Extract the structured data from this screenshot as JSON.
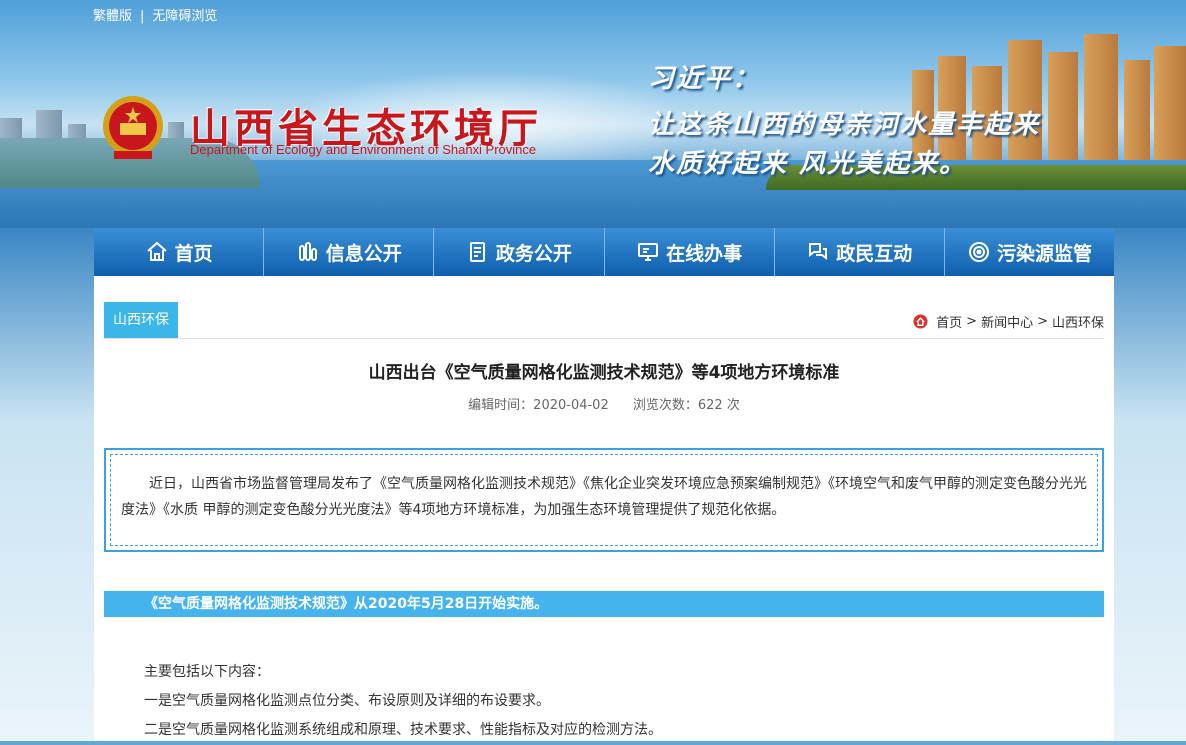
{
  "top_links": {
    "traditional": "繁體版",
    "separator": "|",
    "accessible": "无障碍浏览"
  },
  "header": {
    "title": "山西省生态环境厅",
    "subtitle": "Department of Ecology and Environment of Shanxi Province",
    "quote_author": "习近平：",
    "quote_line1": "让这条山西的母亲河水量丰起来",
    "quote_line2": "水质好起来  风光美起来。"
  },
  "nav": {
    "items": [
      {
        "label": "首页",
        "icon": "home-icon"
      },
      {
        "label": "信息公开",
        "icon": "info-icon"
      },
      {
        "label": "政务公开",
        "icon": "document-icon"
      },
      {
        "label": "在线办事",
        "icon": "monitor-icon"
      },
      {
        "label": "政民互动",
        "icon": "interaction-icon"
      },
      {
        "label": "污染源监管",
        "icon": "target-icon"
      }
    ]
  },
  "section": {
    "tab": "山西环保"
  },
  "breadcrumb": {
    "home": "首页",
    "sep1": ">",
    "news": "新闻中心",
    "sep2": ">",
    "current": "山西环保"
  },
  "article": {
    "title": "山西出台《空气质量网格化监测技术规范》等4项地方环境标准",
    "edit_time": "编辑时间：2020-04-02",
    "views": "浏览次数：622 次",
    "summary": "近日，山西省市场监督管理局发布了《空气质量网格化监测技术规范》《焦化企业突发环境应急预案编制规范》《环境空气和废气甲醇的测定变色酸分光光度法》《水质 甲醇的测定变色酸分光光度法》等4项地方环境标准，为加强生态环境管理提供了规范化依据。",
    "subhead": "《空气质量网格化监测技术规范》从2020年5月28日开始实施。",
    "para1": "主要包括以下内容：",
    "para2": "一是空气质量网格化监测点位分类、布设原则及详细的布设要求。",
    "para3": "二是空气质量网格化监测系统组成和原理、技术要求、性能指标及对应的检测方法。"
  },
  "colors": {
    "nav_bg": "#1f74c2",
    "accent": "#3cb6e8",
    "title_red": "#c8161d"
  }
}
